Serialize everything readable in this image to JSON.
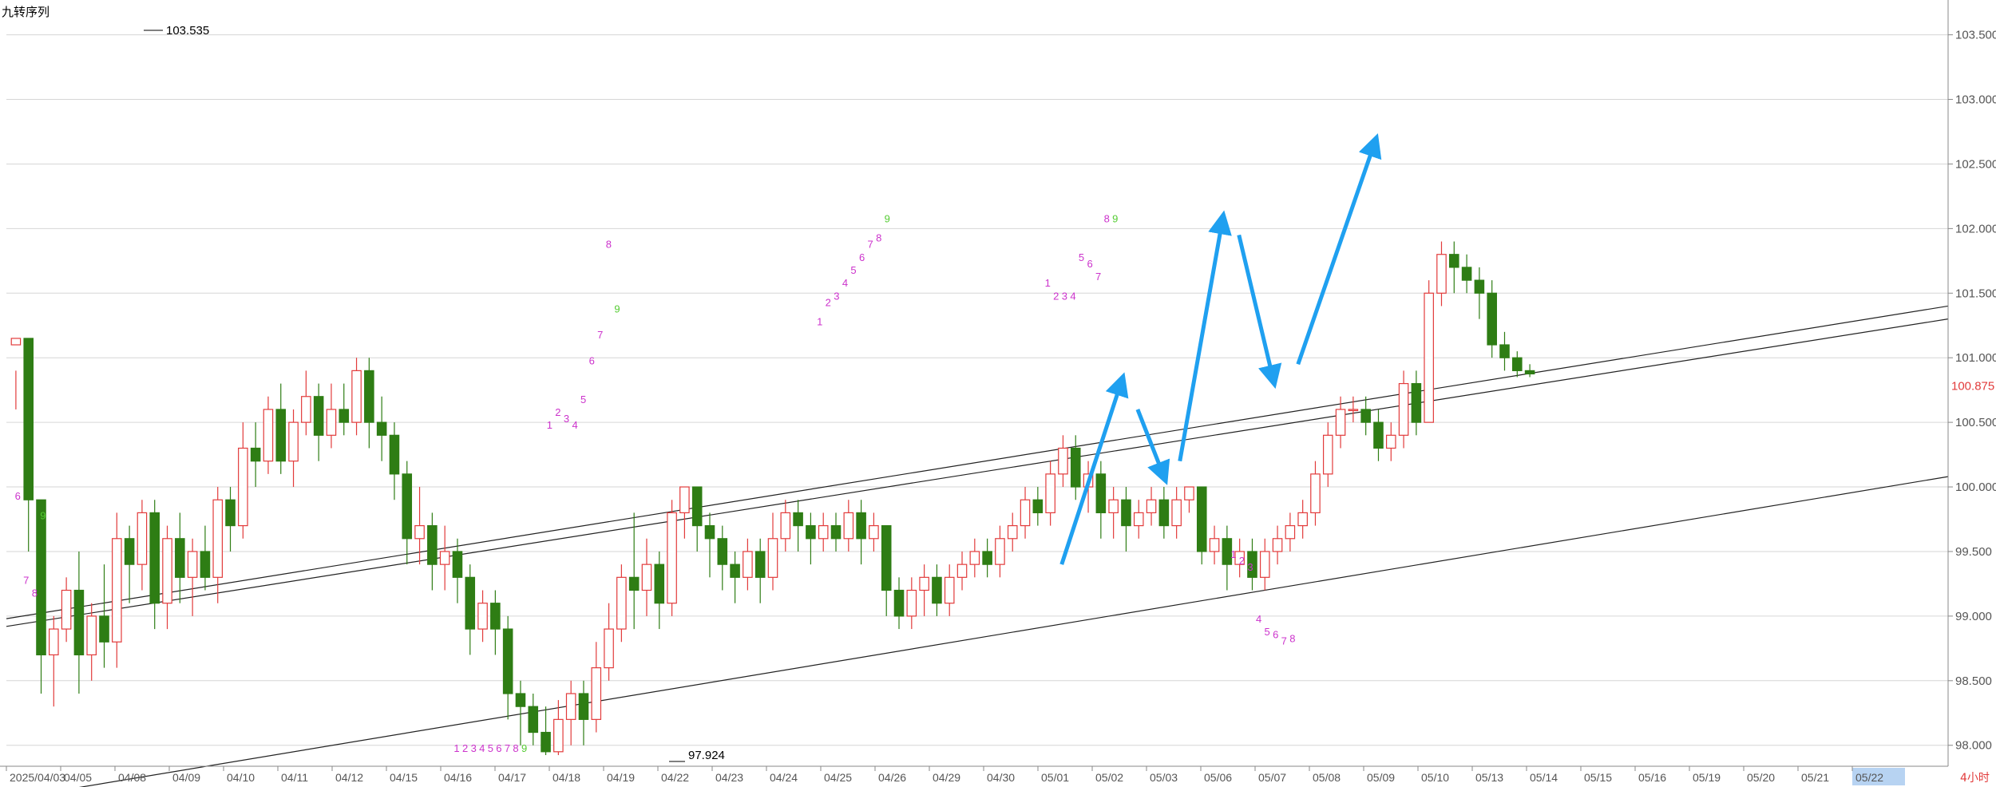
{
  "indicator_title": "九转序列",
  "timeframe_label": "4小时",
  "current_price_label": "100.875",
  "colors": {
    "up": "#e23b3b",
    "down": "#2e7d14",
    "grid": "#d6d6d6",
    "axis": "#888888",
    "seq_magenta": "#cc33cc",
    "seq_green": "#55cc33",
    "arrow": "#1fa0f0",
    "price": "#e23b3b",
    "highlight_bg": "#b7d3f2"
  },
  "chart_data": {
    "type": "candlestick",
    "y_axis_labels": [
      "103.500",
      "103.000",
      "102.500",
      "102.000",
      "101.500",
      "101.000",
      "100.500",
      "100.000",
      "99.500",
      "99.000",
      "98.500",
      "98.000"
    ],
    "ylim": [
      97.85,
      103.72
    ],
    "x_axis_labels": [
      "2025/04/03",
      "04/05",
      "04/08",
      "04/09",
      "04/10",
      "04/11",
      "04/12",
      "04/15",
      "04/16",
      "04/17",
      "04/18",
      "04/19",
      "04/22",
      "04/23",
      "04/24",
      "04/25",
      "04/26",
      "04/29",
      "04/30",
      "05/01",
      "05/02",
      "05/03",
      "05/06",
      "05/07",
      "05/08",
      "05/09",
      "05/10",
      "05/13",
      "05/14",
      "05/15",
      "05/16",
      "05/19",
      "05/20",
      "05/21",
      "05/22"
    ],
    "highlighted_x_label": "05/22",
    "x_range": [
      0,
      230
    ],
    "candles": [
      [
        101.1,
        101.15,
        100.9,
        100.6
      ],
      [
        101.15,
        99.9,
        99.5,
        100.2
      ],
      [
        99.9,
        98.7,
        98.4,
        99.5
      ],
      [
        98.7,
        98.9,
        98.3,
        99.0
      ],
      [
        98.9,
        99.2,
        98.8,
        99.3
      ],
      [
        99.2,
        98.7,
        98.4,
        99.5
      ],
      [
        98.7,
        99.0,
        98.5,
        99.1
      ],
      [
        99.0,
        98.8,
        98.6,
        99.4
      ],
      [
        98.8,
        99.6,
        98.6,
        99.8
      ],
      [
        99.6,
        99.4,
        99.1,
        99.7
      ],
      [
        99.4,
        99.8,
        99.2,
        99.9
      ],
      [
        99.8,
        99.1,
        98.9,
        99.9
      ],
      [
        99.1,
        99.6,
        98.9,
        99.7
      ],
      [
        99.6,
        99.3,
        99.1,
        99.8
      ],
      [
        99.3,
        99.5,
        99.0,
        99.6
      ],
      [
        99.5,
        99.3,
        99.2,
        99.7
      ],
      [
        99.3,
        99.9,
        99.1,
        100.0
      ],
      [
        99.9,
        99.7,
        99.5,
        100.0
      ],
      [
        99.7,
        100.3,
        99.6,
        100.5
      ],
      [
        100.3,
        100.2,
        100.0,
        100.5
      ],
      [
        100.2,
        100.6,
        100.1,
        100.7
      ],
      [
        100.6,
        100.2,
        100.1,
        100.8
      ],
      [
        100.2,
        100.5,
        100.0,
        100.6
      ],
      [
        100.5,
        100.7,
        100.4,
        100.9
      ],
      [
        100.7,
        100.4,
        100.2,
        100.8
      ],
      [
        100.4,
        100.6,
        100.3,
        100.8
      ],
      [
        100.6,
        100.5,
        100.4,
        100.8
      ],
      [
        100.5,
        100.9,
        100.4,
        101.0
      ],
      [
        100.9,
        100.5,
        100.3,
        101.0
      ],
      [
        100.5,
        100.4,
        100.2,
        100.7
      ],
      [
        100.4,
        100.1,
        99.9,
        100.5
      ],
      [
        100.1,
        99.6,
        99.4,
        100.2
      ],
      [
        99.6,
        99.7,
        99.4,
        100.0
      ],
      [
        99.7,
        99.4,
        99.2,
        99.8
      ],
      [
        99.4,
        99.5,
        99.2,
        99.7
      ],
      [
        99.5,
        99.3,
        99.1,
        99.6
      ],
      [
        99.3,
        98.9,
        98.7,
        99.4
      ],
      [
        98.9,
        99.1,
        98.8,
        99.2
      ],
      [
        99.1,
        98.9,
        98.7,
        99.2
      ],
      [
        98.9,
        98.4,
        98.2,
        99.0
      ],
      [
        98.4,
        98.3,
        98.0,
        98.5
      ],
      [
        98.3,
        98.1,
        98.0,
        98.4
      ],
      [
        98.1,
        97.95,
        97.924,
        98.3
      ],
      [
        97.95,
        98.2,
        97.924,
        98.35
      ],
      [
        98.2,
        98.4,
        98.0,
        98.5
      ],
      [
        98.4,
        98.2,
        98.0,
        98.5
      ],
      [
        98.2,
        98.6,
        98.1,
        98.8
      ],
      [
        98.6,
        98.9,
        98.5,
        99.1
      ],
      [
        98.9,
        99.3,
        98.8,
        99.4
      ],
      [
        99.3,
        99.2,
        98.9,
        99.8
      ],
      [
        99.2,
        99.4,
        99.0,
        99.6
      ],
      [
        99.4,
        99.1,
        98.9,
        99.5
      ],
      [
        99.1,
        99.8,
        99.0,
        99.9
      ],
      [
        99.8,
        100.0,
        99.6,
        100.0
      ],
      [
        100.0,
        99.7,
        99.5,
        100.0
      ],
      [
        99.7,
        99.6,
        99.3,
        99.8
      ],
      [
        99.6,
        99.4,
        99.2,
        99.7
      ],
      [
        99.4,
        99.3,
        99.1,
        99.5
      ],
      [
        99.3,
        99.5,
        99.2,
        99.6
      ],
      [
        99.5,
        99.3,
        99.1,
        99.6
      ],
      [
        99.3,
        99.6,
        99.2,
        99.8
      ],
      [
        99.6,
        99.8,
        99.5,
        99.9
      ],
      [
        99.8,
        99.7,
        99.5,
        99.9
      ],
      [
        99.7,
        99.6,
        99.4,
        99.8
      ],
      [
        99.6,
        99.7,
        99.5,
        99.8
      ],
      [
        99.7,
        99.6,
        99.5,
        99.8
      ],
      [
        99.6,
        99.8,
        99.5,
        99.9
      ],
      [
        99.8,
        99.6,
        99.4,
        99.9
      ],
      [
        99.6,
        99.7,
        99.5,
        99.8
      ],
      [
        99.7,
        99.2,
        99.0,
        99.7
      ],
      [
        99.2,
        99.0,
        98.9,
        99.3
      ],
      [
        99.0,
        99.2,
        98.9,
        99.3
      ],
      [
        99.2,
        99.3,
        99.0,
        99.4
      ],
      [
        99.3,
        99.1,
        99.0,
        99.4
      ],
      [
        99.1,
        99.3,
        99.0,
        99.4
      ],
      [
        99.3,
        99.4,
        99.2,
        99.5
      ],
      [
        99.4,
        99.5,
        99.3,
        99.6
      ],
      [
        99.5,
        99.4,
        99.3,
        99.6
      ],
      [
        99.4,
        99.6,
        99.3,
        99.7
      ],
      [
        99.6,
        99.7,
        99.5,
        99.8
      ],
      [
        99.7,
        99.9,
        99.6,
        100.0
      ],
      [
        99.9,
        99.8,
        99.7,
        100.0
      ],
      [
        99.8,
        100.1,
        99.7,
        100.2
      ],
      [
        100.1,
        100.3,
        100.0,
        100.4
      ],
      [
        100.3,
        100.0,
        99.9,
        100.4
      ],
      [
        100.0,
        100.1,
        99.8,
        100.2
      ],
      [
        100.1,
        99.8,
        99.6,
        100.2
      ],
      [
        99.8,
        99.9,
        99.6,
        100.0
      ],
      [
        99.9,
        99.7,
        99.5,
        100.0
      ],
      [
        99.7,
        99.8,
        99.6,
        99.9
      ],
      [
        99.8,
        99.9,
        99.7,
        100.0
      ],
      [
        99.9,
        99.7,
        99.6,
        100.0
      ],
      [
        99.7,
        99.9,
        99.6,
        100.0
      ],
      [
        99.9,
        100.0,
        99.8,
        100.0
      ],
      [
        100.0,
        99.5,
        99.4,
        100.0
      ],
      [
        99.5,
        99.6,
        99.4,
        99.7
      ],
      [
        99.6,
        99.4,
        99.2,
        99.7
      ],
      [
        99.4,
        99.5,
        99.3,
        99.6
      ],
      [
        99.5,
        99.3,
        99.2,
        99.6
      ],
      [
        99.3,
        99.5,
        99.2,
        99.6
      ],
      [
        99.5,
        99.6,
        99.4,
        99.7
      ],
      [
        99.6,
        99.7,
        99.5,
        99.8
      ],
      [
        99.7,
        99.8,
        99.6,
        99.9
      ],
      [
        99.8,
        100.1,
        99.7,
        100.2
      ],
      [
        100.1,
        100.4,
        100.0,
        100.5
      ],
      [
        100.4,
        100.6,
        100.3,
        100.7
      ],
      [
        100.6,
        100.6,
        100.5,
        100.7
      ],
      [
        100.6,
        100.5,
        100.4,
        100.7
      ],
      [
        100.5,
        100.3,
        100.2,
        100.6
      ],
      [
        100.3,
        100.4,
        100.2,
        100.5
      ],
      [
        100.4,
        100.8,
        100.3,
        100.9
      ],
      [
        100.8,
        100.5,
        100.4,
        100.9
      ],
      [
        100.5,
        101.5,
        100.5,
        101.6
      ],
      [
        101.5,
        101.8,
        101.4,
        101.9
      ],
      [
        101.8,
        101.7,
        101.5,
        101.9
      ],
      [
        101.7,
        101.6,
        101.5,
        101.8
      ],
      [
        101.6,
        101.5,
        101.3,
        101.7
      ],
      [
        101.5,
        101.1,
        101.0,
        101.6
      ],
      [
        101.1,
        101.0,
        100.9,
        101.2
      ],
      [
        101.0,
        100.9,
        100.85,
        101.05
      ],
      [
        100.9,
        100.875,
        100.85,
        100.95
      ]
    ],
    "channel_lines": [
      {
        "name": "",
        "x": [
          0,
          230
        ],
        "y": [
          98.98,
          101.4
        ]
      },
      {
        "name": "",
        "x": [
          0,
          230
        ],
        "y": [
          98.92,
          101.3
        ]
      },
      {
        "name": "",
        "x": [
          0,
          230
        ],
        "y": [
          97.58,
          100.08
        ]
      }
    ],
    "peak_label": {
      "text": "103.535",
      "value": 103.535
    },
    "trough_label": {
      "text": "97.924",
      "value": 97.924
    },
    "sequence_marks": [
      {
        "text": "6",
        "x": 1,
        "value": 99.9,
        "color": "magenta"
      },
      {
        "text": "9",
        "x": 4,
        "value": 99.75,
        "color": "green"
      },
      {
        "text": "7",
        "x": 2,
        "value": 99.25,
        "color": "magenta"
      },
      {
        "text": "8",
        "x": 3,
        "value": 99.15,
        "color": "magenta"
      },
      {
        "text": "1",
        "x": 64,
        "value": 100.45,
        "color": "magenta"
      },
      {
        "text": "2",
        "x": 65,
        "value": 100.55,
        "color": "magenta"
      },
      {
        "text": "3",
        "x": 66,
        "value": 100.5,
        "color": "magenta"
      },
      {
        "text": "4",
        "x": 67,
        "value": 100.45,
        "color": "magenta"
      },
      {
        "text": "5",
        "x": 68,
        "value": 100.65,
        "color": "magenta"
      },
      {
        "text": "6",
        "x": 69,
        "value": 100.95,
        "color": "magenta"
      },
      {
        "text": "7",
        "x": 70,
        "value": 101.15,
        "color": "magenta"
      },
      {
        "text": "8",
        "x": 71,
        "value": 101.85,
        "color": "magenta"
      },
      {
        "text": "9",
        "x": 72,
        "value": 101.35,
        "color": "green"
      },
      {
        "text": "1",
        "x": 53,
        "value": 97.95,
        "color": "magenta"
      },
      {
        "text": "2",
        "x": 54,
        "value": 97.95,
        "color": "magenta"
      },
      {
        "text": "3",
        "x": 55,
        "value": 97.95,
        "color": "magenta"
      },
      {
        "text": "4",
        "x": 56,
        "value": 97.95,
        "color": "magenta"
      },
      {
        "text": "5",
        "x": 57,
        "value": 97.95,
        "color": "magenta"
      },
      {
        "text": "6",
        "x": 58,
        "value": 97.95,
        "color": "magenta"
      },
      {
        "text": "7",
        "x": 59,
        "value": 97.95,
        "color": "magenta"
      },
      {
        "text": "8",
        "x": 60,
        "value": 97.95,
        "color": "magenta"
      },
      {
        "text": "9",
        "x": 61,
        "value": 97.95,
        "color": "green"
      },
      {
        "text": "1",
        "x": 96,
        "value": 101.25,
        "color": "magenta"
      },
      {
        "text": "2",
        "x": 97,
        "value": 101.4,
        "color": "magenta"
      },
      {
        "text": "3",
        "x": 98,
        "value": 101.45,
        "color": "magenta"
      },
      {
        "text": "4",
        "x": 99,
        "value": 101.55,
        "color": "magenta"
      },
      {
        "text": "5",
        "x": 100,
        "value": 101.65,
        "color": "magenta"
      },
      {
        "text": "6",
        "x": 101,
        "value": 101.75,
        "color": "magenta"
      },
      {
        "text": "7",
        "x": 102,
        "value": 101.85,
        "color": "magenta"
      },
      {
        "text": "8",
        "x": 103,
        "value": 101.9,
        "color": "magenta"
      },
      {
        "text": "9",
        "x": 104,
        "value": 102.05,
        "color": "green"
      },
      {
        "text": "1",
        "x": 123,
        "value": 101.55,
        "color": "magenta"
      },
      {
        "text": "2",
        "x": 124,
        "value": 101.45,
        "color": "magenta"
      },
      {
        "text": "3",
        "x": 125,
        "value": 101.45,
        "color": "magenta"
      },
      {
        "text": "4",
        "x": 126,
        "value": 101.45,
        "color": "magenta"
      },
      {
        "text": "5",
        "x": 127,
        "value": 101.75,
        "color": "magenta"
      },
      {
        "text": "6",
        "x": 128,
        "value": 101.7,
        "color": "magenta"
      },
      {
        "text": "7",
        "x": 129,
        "value": 101.6,
        "color": "magenta"
      },
      {
        "text": "8",
        "x": 130,
        "value": 102.05,
        "color": "magenta"
      },
      {
        "text": "9",
        "x": 131,
        "value": 102.05,
        "color": "green"
      },
      {
        "text": "1",
        "x": 145,
        "value": 99.45,
        "color": "magenta"
      },
      {
        "text": "2",
        "x": 146,
        "value": 99.4,
        "color": "magenta"
      },
      {
        "text": "3",
        "x": 147,
        "value": 99.35,
        "color": "magenta"
      },
      {
        "text": "4",
        "x": 148,
        "value": 98.95,
        "color": "magenta"
      },
      {
        "text": "5",
        "x": 149,
        "value": 98.85,
        "color": "magenta"
      },
      {
        "text": "6",
        "x": 150,
        "value": 98.83,
        "color": "magenta"
      },
      {
        "text": "7",
        "x": 151,
        "value": 98.78,
        "color": "magenta"
      },
      {
        "text": "8",
        "x": 152,
        "value": 98.8,
        "color": "magenta"
      }
    ],
    "arrows": [
      {
        "from": [
          125,
          99.4
        ],
        "to": [
          132,
          100.8
        ]
      },
      {
        "from": [
          134,
          100.6
        ],
        "to": [
          137,
          100.1
        ]
      },
      {
        "from": [
          139,
          100.2
        ],
        "to": [
          144,
          102.05
        ]
      },
      {
        "from": [
          146,
          101.95
        ],
        "to": [
          150,
          100.85
        ]
      },
      {
        "from": [
          153,
          100.95
        ],
        "to": [
          162,
          102.65
        ]
      }
    ]
  }
}
